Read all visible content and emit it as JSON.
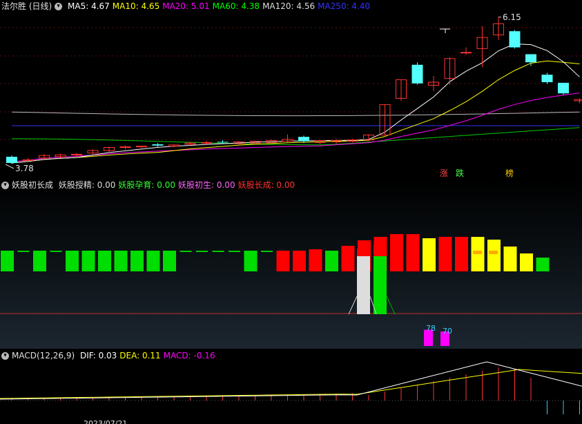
{
  "main": {
    "title": "法尔胜 (日线)",
    "ma": [
      {
        "label": "MA5:",
        "value": "4.67",
        "color": "#ffffff"
      },
      {
        "label": "MA10:",
        "value": "4.65",
        "color": "#ffff00"
      },
      {
        "label": "MA20:",
        "value": "5.01",
        "color": "#ff00ff"
      },
      {
        "label": "MA60:",
        "value": "4.38",
        "color": "#00ff00"
      },
      {
        "label": "MA120:",
        "value": "4.56",
        "color": "#dddddd"
      },
      {
        "label": "MA250:",
        "value": "4.40",
        "color": "#3333ff"
      }
    ],
    "high_label": "6.15",
    "low_label": "3.78",
    "signals": [
      {
        "text": "涨",
        "color": "#ff4444"
      },
      {
        "text": "跌",
        "color": "#44ff44"
      },
      {
        "text": "榜",
        "color": "#ffcc00"
      }
    ],
    "candles": [
      [
        3.9,
        3.92,
        3.78,
        3.8
      ],
      [
        3.84,
        3.88,
        3.82,
        3.85
      ],
      [
        3.88,
        3.94,
        3.86,
        3.92
      ],
      [
        3.9,
        3.95,
        3.88,
        3.93
      ],
      [
        3.93,
        3.96,
        3.9,
        3.94
      ],
      [
        3.96,
        4.02,
        3.94,
        4.0
      ],
      [
        4.0,
        4.06,
        3.98,
        4.05
      ],
      [
        4.06,
        4.08,
        4.02,
        4.06
      ],
      [
        4.06,
        4.08,
        4.04,
        4.07
      ],
      [
        4.1,
        4.12,
        4.06,
        4.08
      ],
      [
        4.07,
        4.1,
        4.05,
        4.09
      ],
      [
        4.1,
        4.14,
        4.08,
        4.12
      ],
      [
        4.12,
        4.16,
        4.1,
        4.13
      ],
      [
        4.14,
        4.17,
        4.11,
        4.13
      ],
      [
        4.11,
        4.15,
        4.1,
        4.14
      ],
      [
        4.12,
        4.16,
        4.1,
        4.15
      ],
      [
        4.13,
        4.18,
        4.11,
        4.16
      ],
      [
        4.15,
        4.26,
        4.13,
        4.18
      ],
      [
        4.22,
        4.24,
        4.12,
        4.15
      ],
      [
        4.13,
        4.17,
        4.1,
        4.16
      ],
      [
        4.14,
        4.18,
        4.11,
        4.16
      ],
      [
        4.15,
        4.19,
        4.13,
        4.17
      ],
      [
        4.17,
        4.26,
        4.15,
        4.25
      ],
      [
        4.25,
        4.74,
        4.24,
        4.74
      ],
      [
        4.84,
        5.14,
        4.8,
        5.14
      ],
      [
        5.38,
        5.42,
        5.06,
        5.08
      ],
      [
        5.05,
        5.2,
        4.96,
        5.1
      ],
      [
        5.16,
        5.5,
        5.06,
        5.48
      ],
      [
        5.58,
        5.66,
        5.54,
        5.58
      ],
      [
        5.64,
        6.0,
        5.34,
        5.82
      ],
      [
        5.86,
        6.15,
        5.78,
        6.04
      ],
      [
        5.92,
        5.94,
        5.64,
        5.66
      ],
      [
        5.55,
        5.55,
        5.36,
        5.42
      ],
      [
        5.22,
        5.25,
        5.07,
        5.1
      ],
      [
        5.09,
        5.09,
        4.9,
        4.92
      ],
      [
        4.8,
        4.84,
        4.76,
        4.82
      ]
    ]
  },
  "indicator": {
    "title": "妖股初长成",
    "items": [
      {
        "label": "妖股授精:",
        "value": "0.00",
        "color": "#dddddd"
      },
      {
        "label": "妖股孕育:",
        "value": "0.00",
        "color": "#33ff33"
      },
      {
        "label": "妖股初生:",
        "value": "0.00",
        "color": "#ff66ff"
      },
      {
        "label": "妖股长成:",
        "value": "0.00",
        "color": "#ff3333"
      }
    ],
    "bars": [
      "g",
      "d",
      "g",
      "d",
      "g",
      "g",
      "g",
      "g",
      "g",
      "g",
      "g",
      "d",
      "d",
      "d",
      "d",
      "g",
      "d",
      "r",
      "r",
      "r",
      "g",
      "r",
      "r",
      "r",
      "r",
      "r",
      "y",
      "r",
      "r",
      "y",
      "y",
      "y",
      "y",
      "g"
    ],
    "marks": [
      "78",
      "70"
    ],
    "pink_values": [
      78,
      70
    ]
  },
  "macd": {
    "title": "MACD(12,26,9)",
    "items": [
      {
        "label": "DIF:",
        "value": "0.03",
        "color": "#ffffff"
      },
      {
        "label": "DEA:",
        "value": "0.11",
        "color": "#ffff00"
      },
      {
        "label": "MACD:",
        "value": "-0.16",
        "color": "#ff00ff"
      }
    ],
    "date_partial": "2023/07/21"
  }
}
